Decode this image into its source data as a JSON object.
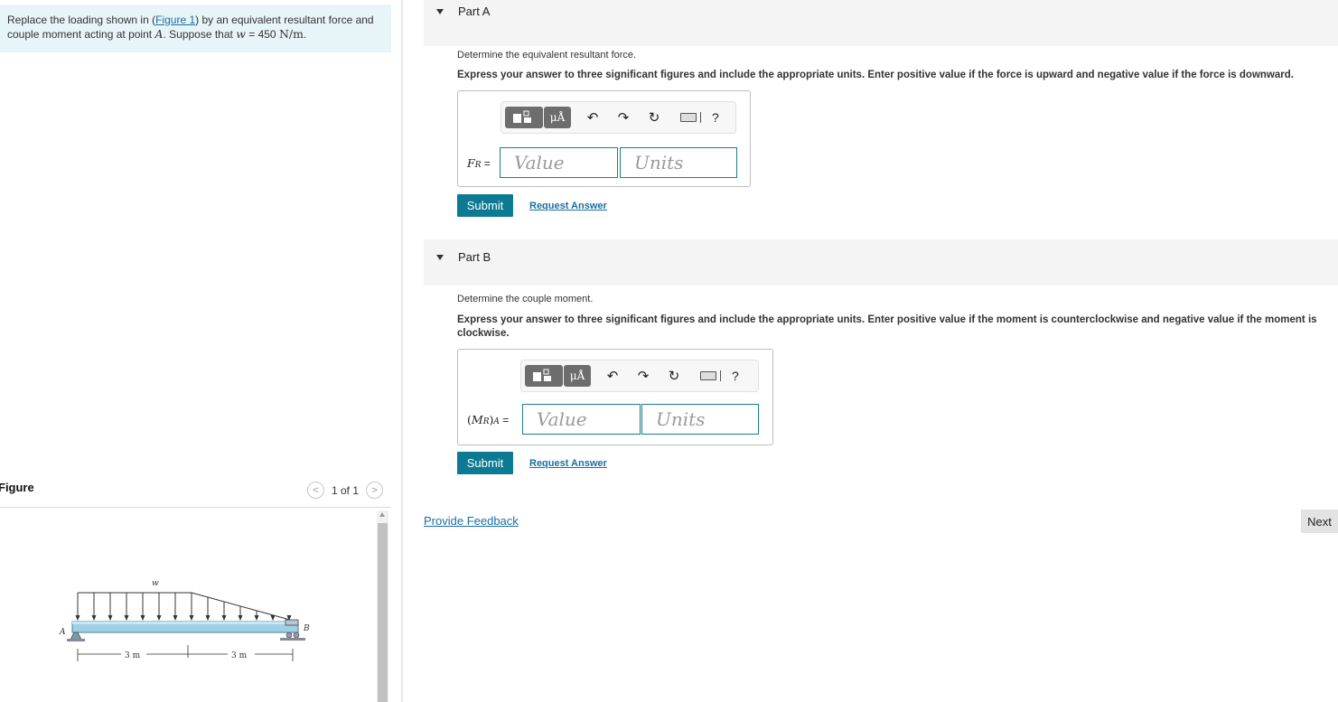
{
  "problem": {
    "text_before_link": "Replace the loading shown in (",
    "link": "Figure 1",
    "text_after_link": ") by an equivalent resultant force and couple moment acting at point ",
    "point": "A",
    "text_suppose": ". Suppose that ",
    "var": "w",
    "equals": " = 450 ",
    "unit": "N/m",
    "end": "."
  },
  "figure": {
    "title": "Figure",
    "page": "1 of 1",
    "prev_icon": "<",
    "next_icon": ">",
    "labels": {
      "w": "w",
      "A": "A",
      "B": "B",
      "dim1": "3 m",
      "dim2": "3 m"
    }
  },
  "partA": {
    "title": "Part A",
    "question": "Determine the equivalent resultant force.",
    "instruction": "Express your answer to three significant figures and include the appropriate units. Enter positive value if the force is upward and negative value if the force is downward.",
    "label_var": "F",
    "label_sub": "R",
    "label_eq": " =",
    "value_placeholder": "Value",
    "units_placeholder": "Units",
    "submit": "Submit",
    "request": "Request Answer"
  },
  "partB": {
    "title": "Part B",
    "question": "Determine the couple moment.",
    "instruction": "Express your answer to three significant figures and include the appropriate units. Enter positive value if the moment is counterclockwise and negative value if the moment is clockwise.",
    "label_open": "(",
    "label_var": "M",
    "label_sub": "R",
    "label_close": ")",
    "label_sub2": "A",
    "label_eq": " =",
    "value_placeholder": "Value",
    "units_placeholder": "Units",
    "submit": "Submit",
    "request": "Request Answer"
  },
  "toolbar": {
    "units_btn": "μÅ",
    "undo": "↶",
    "redo": "↷",
    "reset": "↻",
    "help": "?"
  },
  "footer": {
    "feedback": "Provide Feedback",
    "next": "Next"
  },
  "colors": {
    "problem_bg": "#e8f5f8",
    "link": "#1a6fa0",
    "submit_bg": "#0c7a92",
    "input_border": "#1a7c8f",
    "part_header_bg": "#f4f4f4",
    "beam": "#9fd0e6"
  }
}
